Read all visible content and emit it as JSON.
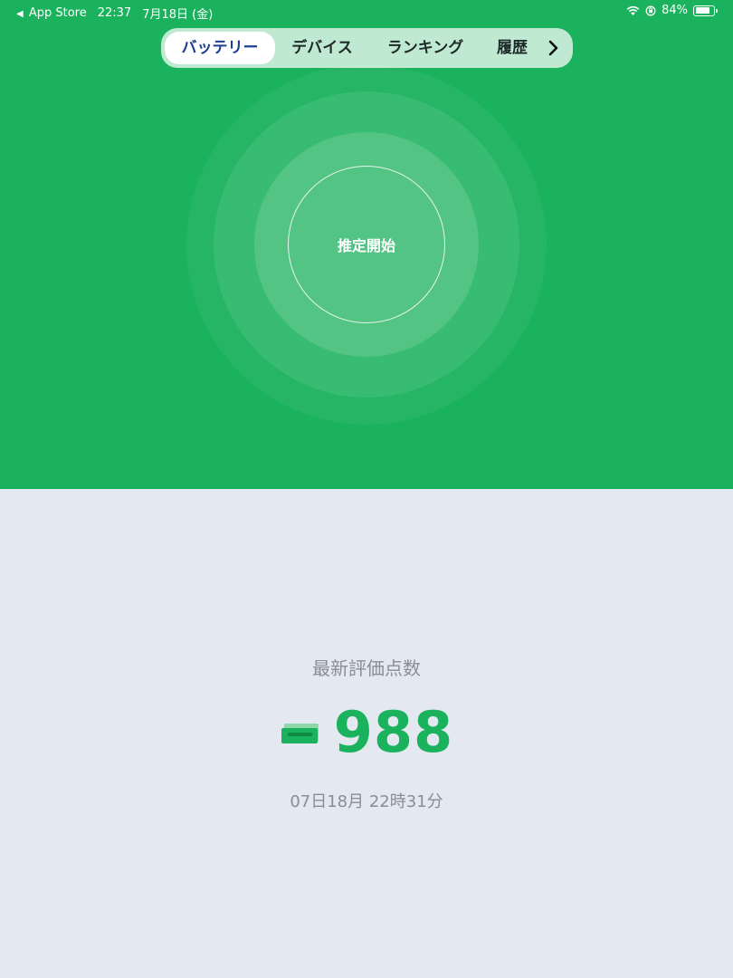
{
  "status_bar": {
    "back_label": "App Store",
    "time": "22:37",
    "date": "7月18日 (金)",
    "battery_percent": "84%",
    "battery_level": 0.84
  },
  "tabs": [
    {
      "label": "バッテリー",
      "active": true
    },
    {
      "label": "デバイス",
      "active": false
    },
    {
      "label": "ランキング",
      "active": false
    },
    {
      "label": "履歴",
      "active": false
    }
  ],
  "start_button": {
    "label": "推定開始"
  },
  "score": {
    "label": "最新評価点数",
    "value": "988",
    "timestamp": "07日18月 22時31分"
  },
  "colors": {
    "primary_green": "#1ab25c",
    "active_tab_text": "#1f3f95",
    "background": "#e4e8f0",
    "muted_text": "#8a8d94"
  }
}
